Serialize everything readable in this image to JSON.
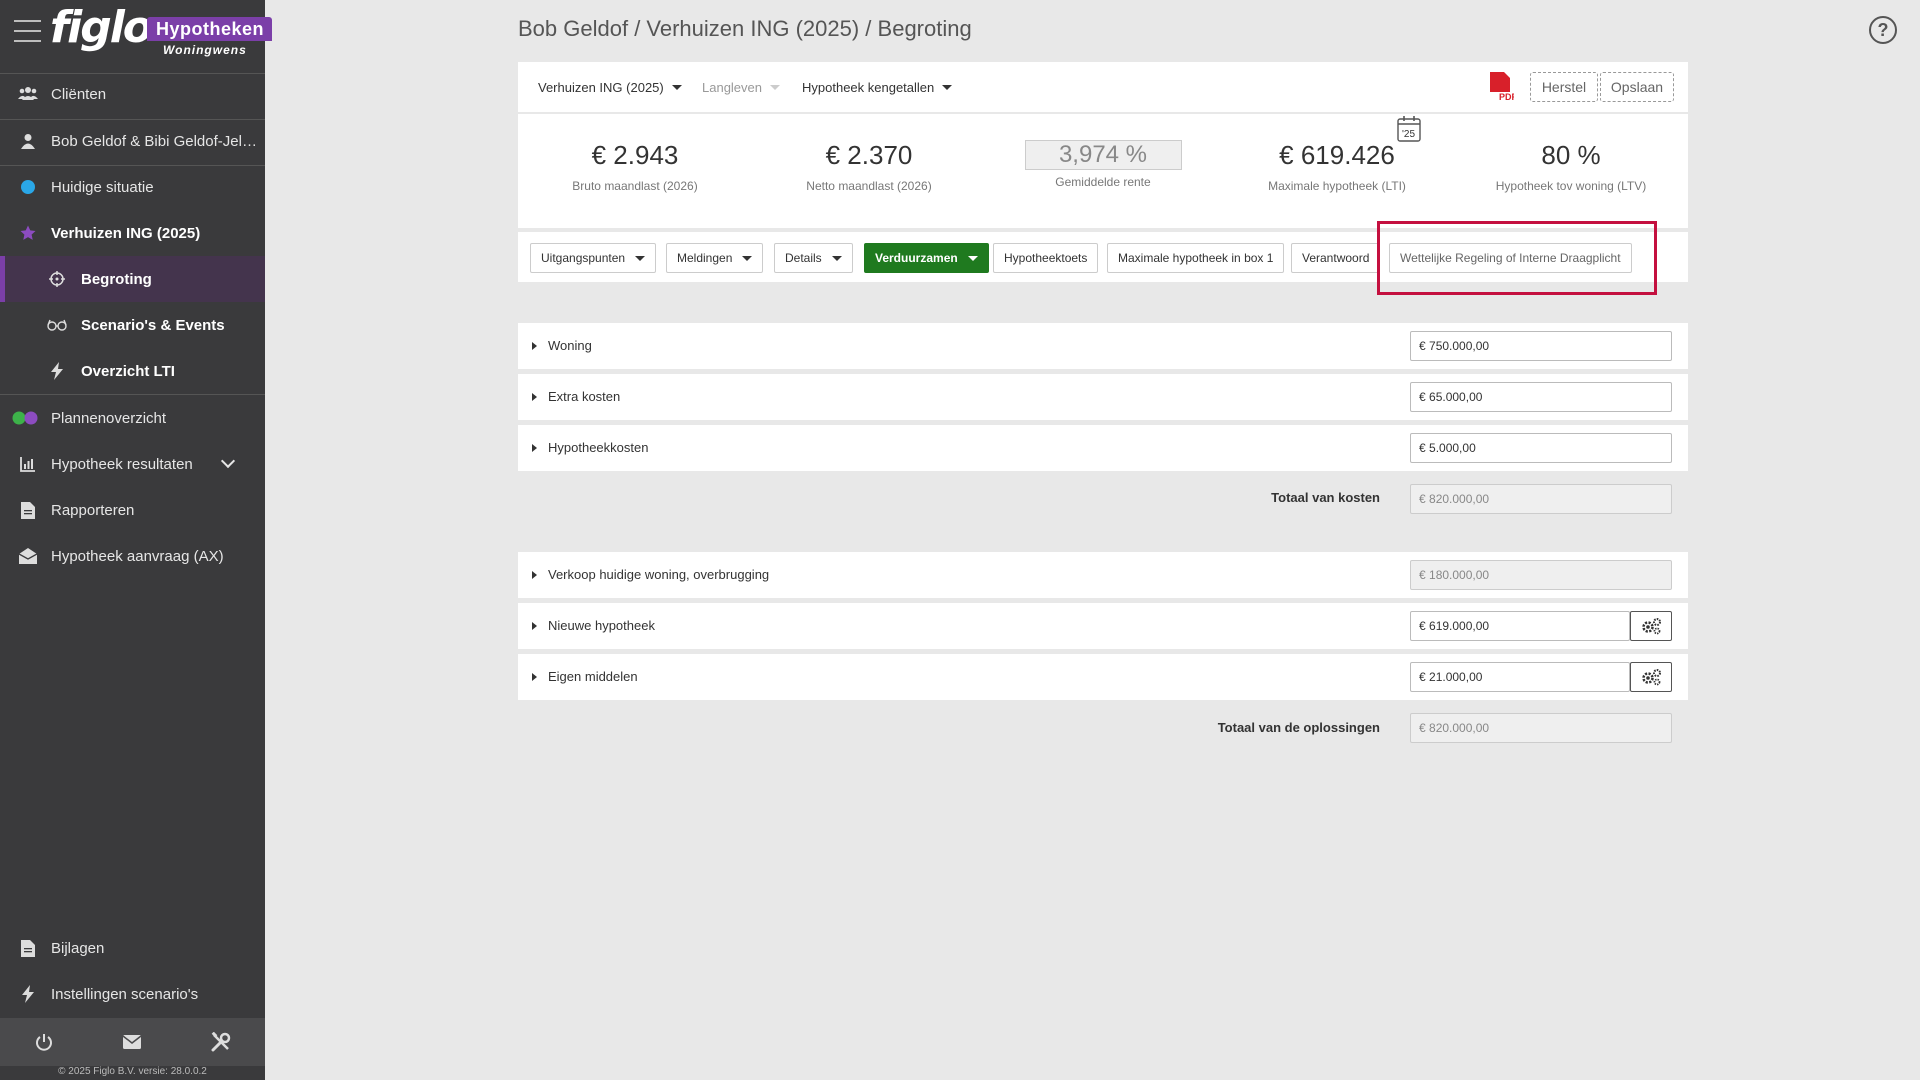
{
  "brand": {
    "logo": "figlo",
    "badge": "Hypotheken",
    "sub": "Woningwens"
  },
  "sidebar": {
    "items": [
      {
        "label": "Cliënten",
        "icon": "users-icon"
      },
      {
        "label": "Bob Geldof & Bibi Geldof-Jelev...",
        "icon": "user-icon"
      },
      {
        "label": "Huidige situatie",
        "icon": "dot-icon"
      },
      {
        "label": "Verhuizen ING (2025)",
        "icon": "star-icon"
      },
      {
        "label": "Begroting",
        "icon": "target-icon"
      },
      {
        "label": "Scenario's & Events",
        "icon": "glasses-icon"
      },
      {
        "label": "Overzicht LTI",
        "icon": "bolt-icon"
      },
      {
        "label": "Plannenoverzicht",
        "icon": "toggle-icon"
      },
      {
        "label": "Hypotheek resultaten",
        "icon": "chart-icon"
      },
      {
        "label": "Rapporteren",
        "icon": "document-icon"
      },
      {
        "label": "Hypotheek aanvraag (AX)",
        "icon": "envelope-open-icon"
      },
      {
        "label": "Bijlagen",
        "icon": "file-icon"
      },
      {
        "label": "Instellingen scenario's",
        "icon": "bolt-icon"
      }
    ],
    "copyright": "© 2025 Figlo B.V. versie: 28.0.0.2"
  },
  "header": {
    "breadcrumb": "Bob Geldof / Verhuizen ING (2025) / Begroting"
  },
  "toolbar": {
    "dropdowns": [
      "Verhuizen ING (2025)",
      "Langleven",
      "Hypotheek kengetallen"
    ],
    "herstel": "Herstel",
    "opslaan": "Opslaan",
    "pdf": "PDF"
  },
  "kpis": [
    {
      "value": "€ 2.943",
      "label": "Bruto maandlast (2026)"
    },
    {
      "value": "€ 2.370",
      "label": "Netto maandlast (2026)"
    },
    {
      "value": "3,974 %",
      "label": "Gemiddelde rente"
    },
    {
      "value": "€ 619.426",
      "label": "Maximale hypotheek (LTI)"
    },
    {
      "value": "80 %",
      "label": "Hypotheek tov woning (LTV)"
    }
  ],
  "calendar_badge": "'25",
  "tabs": [
    "Uitgangspunten",
    "Meldingen",
    "Details",
    "Verduurzamen",
    "Hypotheektoets",
    "Maximale hypotheek in box 1",
    "Verantwoord",
    "Wettelijke Regeling of Interne Draagplicht"
  ],
  "costs": [
    {
      "label": "Woning",
      "value": "750.000,00"
    },
    {
      "label": "Extra kosten",
      "value": "65.000,00"
    },
    {
      "label": "Hypotheekkosten",
      "value": "5.000,00"
    }
  ],
  "total_costs": {
    "label": "Totaal van kosten",
    "value": "820.000,00"
  },
  "solutions": [
    {
      "label": "Verkoop huidige woning, overbrugging",
      "value": "180.000,00"
    },
    {
      "label": "Nieuwe hypotheek",
      "value": "619.000,00"
    },
    {
      "label": "Eigen middelen",
      "value": "21.000,00"
    }
  ],
  "total_solutions": {
    "label": "Totaal van de oplossingen",
    "value": "820.000,00"
  },
  "currency": "€",
  "colors": {
    "accent": "#7b3fa8",
    "green": "#1f7a1f",
    "highlight": "#c4103f",
    "pdf": "#d8202a"
  }
}
